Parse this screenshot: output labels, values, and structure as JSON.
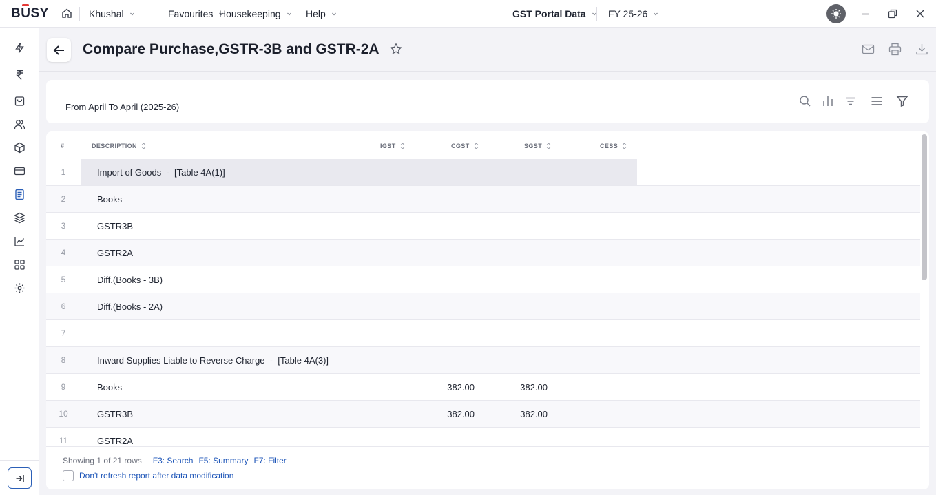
{
  "app": {
    "logo": "BUSY",
    "logo_parts": [
      "B",
      "U",
      "SY"
    ]
  },
  "topbar": {
    "menus": [
      {
        "label": "Khushal"
      },
      {
        "label": "Favourites"
      },
      {
        "label": "Housekeeping"
      },
      {
        "label": "Help"
      }
    ],
    "gst_label": "GST Portal Data",
    "fy_label": "FY 25-26"
  },
  "page": {
    "title": "Compare Purchase,GSTR-3B and GSTR-2A",
    "date_range": "From April To April (2025-26)"
  },
  "table": {
    "headers": {
      "num": "#",
      "description": "DESCRIPTION",
      "igst": "IGST",
      "cgst": "CGST",
      "sgst": "SGST",
      "cess": "CESS"
    },
    "rows": [
      {
        "num": "1",
        "description": "Import of Goods  -  [Table 4A(1)]",
        "igst": "",
        "cgst": "",
        "sgst": "",
        "cess": "",
        "highlight": true
      },
      {
        "num": "2",
        "description": "Books",
        "igst": "",
        "cgst": "",
        "sgst": "",
        "cess": ""
      },
      {
        "num": "3",
        "description": "GSTR3B",
        "igst": "",
        "cgst": "",
        "sgst": "",
        "cess": ""
      },
      {
        "num": "4",
        "description": "GSTR2A",
        "igst": "",
        "cgst": "",
        "sgst": "",
        "cess": ""
      },
      {
        "num": "5",
        "description": "Diff.(Books - 3B)",
        "igst": "",
        "cgst": "",
        "sgst": "",
        "cess": ""
      },
      {
        "num": "6",
        "description": "Diff.(Books - 2A)",
        "igst": "",
        "cgst": "",
        "sgst": "",
        "cess": ""
      },
      {
        "num": "7",
        "description": "",
        "igst": "",
        "cgst": "",
        "sgst": "",
        "cess": ""
      },
      {
        "num": "8",
        "description": "Inward Supplies Liable to Reverse Charge  -  [Table 4A(3)]",
        "igst": "",
        "cgst": "",
        "sgst": "",
        "cess": ""
      },
      {
        "num": "9",
        "description": "Books",
        "igst": "",
        "cgst": "382.00",
        "sgst": "382.00",
        "cess": ""
      },
      {
        "num": "10",
        "description": "GSTR3B",
        "igst": "",
        "cgst": "382.00",
        "sgst": "382.00",
        "cess": ""
      },
      {
        "num": "11",
        "description": "GSTR2A",
        "igst": "",
        "cgst": "",
        "sgst": "",
        "cess": ""
      }
    ]
  },
  "footer": {
    "showing": "Showing 1 of 21 rows",
    "shortcuts": [
      "F3: Search",
      "F5: Summary",
      "F7: Filter"
    ],
    "checkbox_label": "Don't refresh report after data modification"
  },
  "colors": {
    "accent": "#1d55b8",
    "logo_red": "#e53935",
    "highlight_row": "#e9e9ef"
  }
}
